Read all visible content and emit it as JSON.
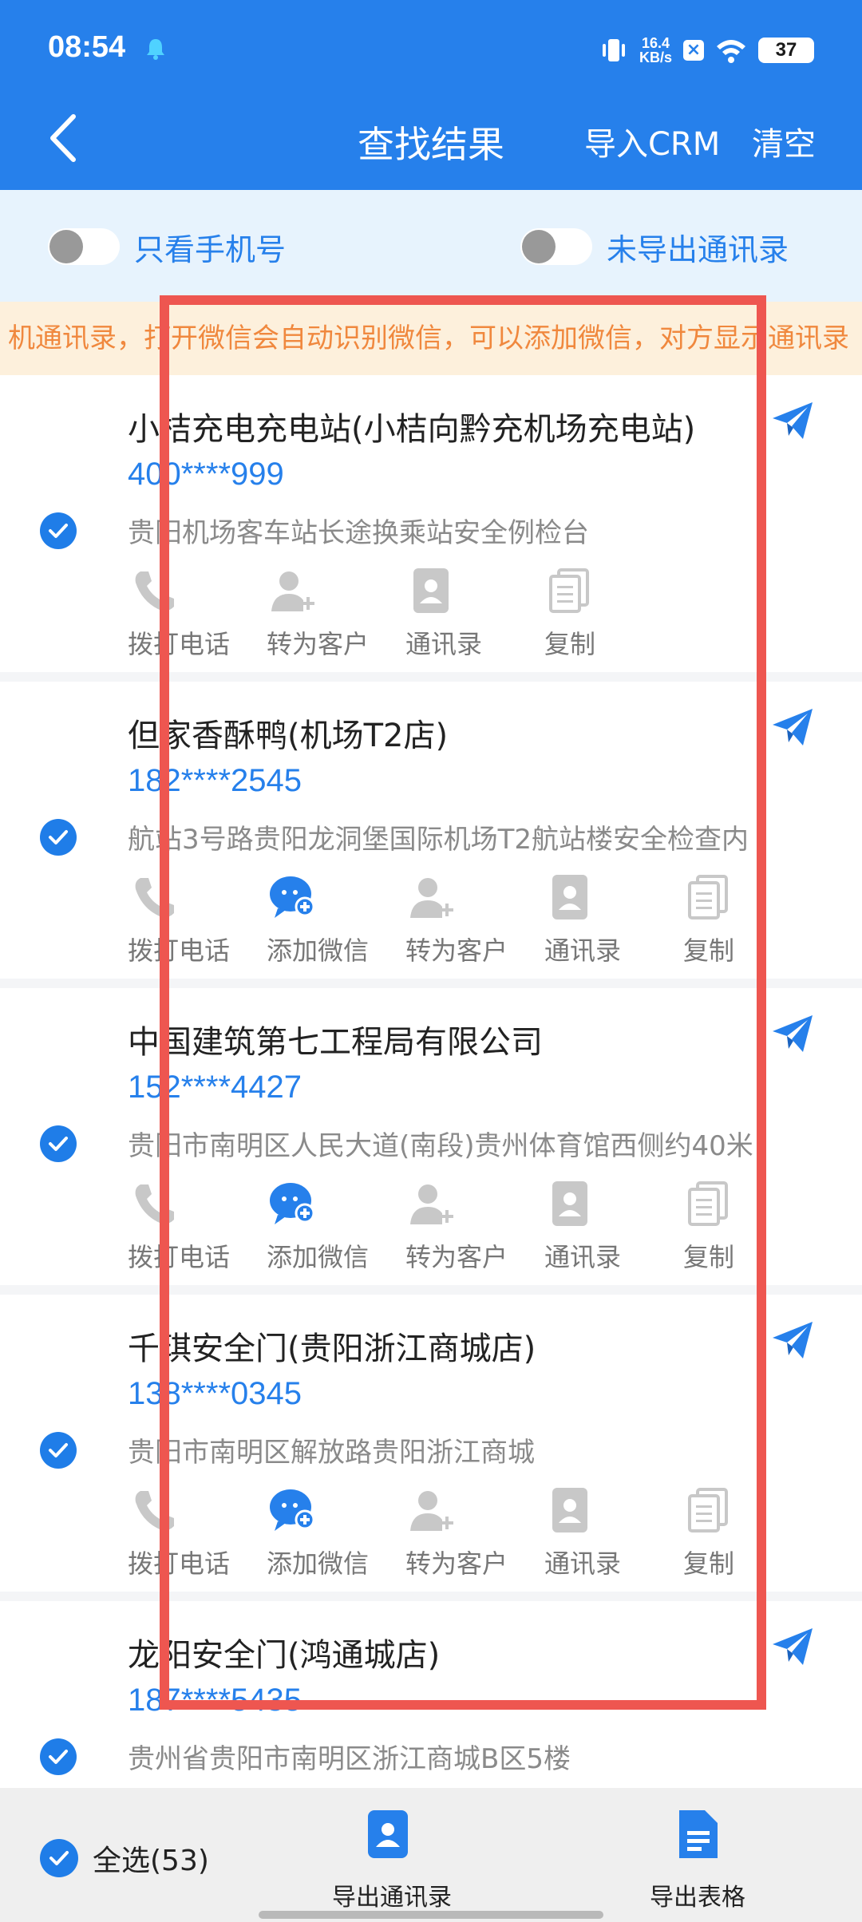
{
  "status_bar": {
    "time": "08:54",
    "net_speed_value": "16.4",
    "net_speed_unit": "KB/s",
    "battery": "37"
  },
  "header": {
    "title": "查找结果",
    "import_label": "导入CRM",
    "clear_label": "清空"
  },
  "filters": {
    "phone_only": "只看手机号",
    "not_exported": "未导出通讯录"
  },
  "notice": "机通讯录，打开微信会自动识别微信，可以添加微信，对方显示通讯录",
  "cards": [
    {
      "title": "小桔充电充电站(小桔向黔充机场充电站)",
      "phone": "400****999",
      "address": "贵阳机场客车站长途换乘站安全例检台",
      "actions": [
        {
          "label": "拨打电话",
          "icon": "phone-icon"
        },
        {
          "label": "转为客户",
          "icon": "add-customer-icon"
        },
        {
          "label": "通讯录",
          "icon": "contacts-icon"
        },
        {
          "label": "复制",
          "icon": "copy-icon"
        }
      ]
    },
    {
      "title": "但家香酥鸭(机场T2店)",
      "phone": "182****2545",
      "address": "航站3号路贵阳龙洞堡国际机场T2航站楼安全检查内",
      "actions": [
        {
          "label": "拨打电话",
          "icon": "phone-icon"
        },
        {
          "label": "添加微信",
          "icon": "wechat-add-icon"
        },
        {
          "label": "转为客户",
          "icon": "add-customer-icon"
        },
        {
          "label": "通讯录",
          "icon": "contacts-icon"
        },
        {
          "label": "复制",
          "icon": "copy-icon"
        }
      ]
    },
    {
      "title": "中国建筑第七工程局有限公司",
      "phone": "152****4427",
      "address": "贵阳市南明区人民大道(南段)贵州体育馆西侧约40米",
      "actions": [
        {
          "label": "拨打电话",
          "icon": "phone-icon"
        },
        {
          "label": "添加微信",
          "icon": "wechat-add-icon"
        },
        {
          "label": "转为客户",
          "icon": "add-customer-icon"
        },
        {
          "label": "通讯录",
          "icon": "contacts-icon"
        },
        {
          "label": "复制",
          "icon": "copy-icon"
        }
      ]
    },
    {
      "title": "千琪安全门(贵阳浙江商城店)",
      "phone": "138****0345",
      "address": "贵阳市南明区解放路贵阳浙江商城",
      "actions": [
        {
          "label": "拨打电话",
          "icon": "phone-icon"
        },
        {
          "label": "添加微信",
          "icon": "wechat-add-icon"
        },
        {
          "label": "转为客户",
          "icon": "add-customer-icon"
        },
        {
          "label": "通讯录",
          "icon": "contacts-icon"
        },
        {
          "label": "复制",
          "icon": "copy-icon"
        }
      ]
    },
    {
      "title": "龙阳安全门(鸿通城店)",
      "phone": "187****5435",
      "address": "贵州省贵阳市南明区浙江商城B区5楼",
      "actions": []
    }
  ],
  "bottom": {
    "select_all": "全选(53)",
    "export_contacts": "导出通讯录",
    "export_sheet": "导出表格"
  },
  "colors": {
    "brand_blue": "#2680eb",
    "highlight_red": "#ee5650",
    "notice_orange": "#f0883e"
  }
}
